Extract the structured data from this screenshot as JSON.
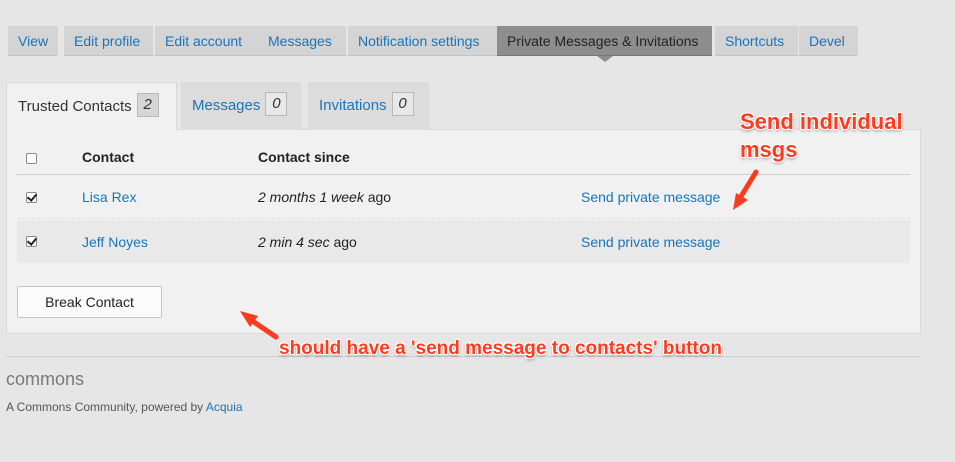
{
  "top_tabs": [
    {
      "label": "View"
    },
    {
      "label": "Edit profile"
    },
    {
      "label": "Edit account"
    },
    {
      "label": "Messages"
    },
    {
      "label": "Notification settings"
    },
    {
      "label": "Private Messages & Invitations"
    },
    {
      "label": "Shortcuts"
    },
    {
      "label": "Devel"
    }
  ],
  "sub_tabs": [
    {
      "label": "Trusted Contacts",
      "count": "2"
    },
    {
      "label": "Messages",
      "count": "0"
    },
    {
      "label": "Invitations",
      "count": "0"
    }
  ],
  "table": {
    "headers": {
      "contact": "Contact",
      "since": "Contact since"
    },
    "rows": [
      {
        "name": "Lisa Rex",
        "since_em": "2 months 1 week",
        "since_suffix": " ago",
        "action": "Send private message",
        "checked": true
      },
      {
        "name": "Jeff Noyes",
        "since_em": "2 min 4 sec",
        "since_suffix": " ago",
        "action": "Send private message",
        "checked": true
      }
    ]
  },
  "break_button": "Break Contact",
  "footer": {
    "brand": "commons",
    "credit_prefix": "A Commons Community, powered by ",
    "credit_link": "Acquia"
  },
  "annotations": {
    "note1_line1": "Send individual",
    "note1_line2": "msgs",
    "note2": "should have a 'send message to contacts' button"
  },
  "colors": {
    "link": "#1b74b8",
    "annotation": "#ff3b1f",
    "active_tab": "#8d8d8d"
  }
}
